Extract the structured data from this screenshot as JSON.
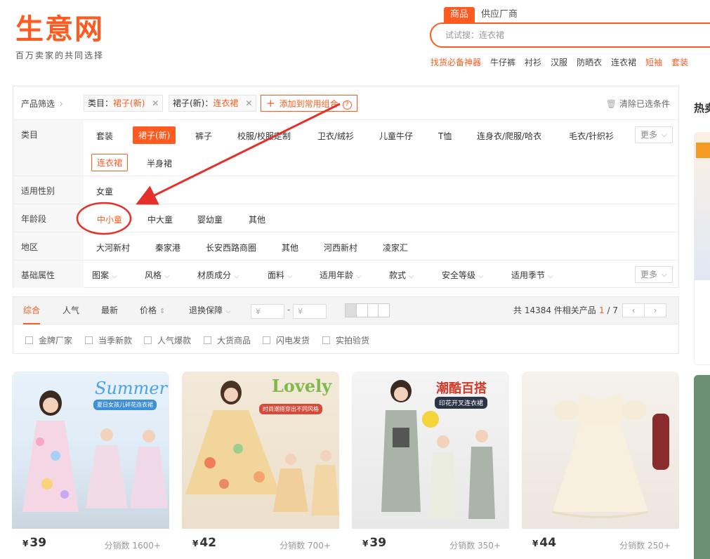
{
  "header": {
    "logo_text": "生意网",
    "logo_slogan": "百万卖家的共同选择",
    "search_tabs": [
      "商品",
      "供应厂商"
    ],
    "search_placeholder": "试试搜：连衣裙",
    "hot_words": [
      {
        "label": "找货必备神器",
        "highlight": true
      },
      {
        "label": "牛仔裤",
        "highlight": false
      },
      {
        "label": "衬衫",
        "highlight": false
      },
      {
        "label": "汉服",
        "highlight": false
      },
      {
        "label": "防晒衣",
        "highlight": false
      },
      {
        "label": "连衣裙",
        "highlight": false
      },
      {
        "label": "短袖",
        "highlight": true
      },
      {
        "label": "套装",
        "highlight": true
      }
    ]
  },
  "filter": {
    "product_filter_label": "产品筛选",
    "chips": [
      {
        "key": "类目：",
        "value": "裙子(新)"
      },
      {
        "key": "裙子(新)：",
        "value": "连衣裙"
      }
    ],
    "add_combo_label": "添加到常用组合",
    "clear_label": "清除已选条件",
    "more_label": "更多",
    "rows": {
      "category": {
        "label": "类目",
        "items": [
          "套装",
          "裙子(新)",
          "裤子",
          "校服/校服定制",
          "卫衣/绒衫",
          "儿童牛仔",
          "T恤",
          "连身衣/爬服/哈衣",
          "毛衣/针织衫"
        ],
        "sub_items": [
          "连衣裙",
          "半身裙"
        ]
      },
      "gender": {
        "label": "适用性别",
        "items": [
          "女童"
        ]
      },
      "age": {
        "label": "年龄段",
        "items": [
          "中小童",
          "中大童",
          "婴幼童",
          "其他"
        ]
      },
      "region": {
        "label": "地区",
        "items": [
          "大河新村",
          "秦家港",
          "长安西路商圈",
          "其他",
          "河西新村",
          "凌家汇"
        ]
      },
      "attrs": {
        "label": "基础属性",
        "items": [
          "图案",
          "风格",
          "材质成分",
          "面料",
          "适用年龄",
          "款式",
          "安全等级",
          "适用季节"
        ]
      }
    }
  },
  "sortbar": {
    "items": [
      "综合",
      "人气",
      "最新",
      "价格",
      "退换保障"
    ],
    "price_from_placeholder": "¥",
    "price_to_placeholder": "¥",
    "price_separator": "-",
    "result_count": "共 14384 件相关产品",
    "page_current": "1",
    "page_total": "/ 7",
    "prev": "‹",
    "next": "›"
  },
  "checkboxes": [
    "金牌厂家",
    "当季新款",
    "人气爆款",
    "大货商品",
    "闪电发货",
    "实拍验货"
  ],
  "products": [
    {
      "price": "39",
      "sales": "分销数 1600+",
      "caption": "Summer",
      "subcaption": "夏日女孩儿碎花连衣裙"
    },
    {
      "price": "42",
      "sales": "分销数 700+",
      "caption": "Lovely",
      "subcaption": "时尚潮搭穿出不同风格"
    },
    {
      "price": "39",
      "sales": "分销数 350+",
      "caption": "潮酷百搭",
      "subcaption": "印花开叉连衣裙"
    },
    {
      "price": "44",
      "sales": "分销数 250+",
      "caption": "",
      "subcaption": ""
    }
  ],
  "currency": "¥",
  "sidebar": {
    "title": "热卖"
  }
}
